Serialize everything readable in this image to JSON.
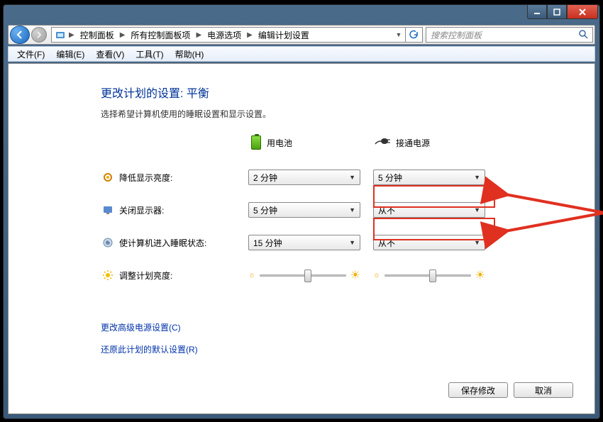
{
  "breadcrumb": {
    "items": [
      "控制面板",
      "所有控制面板项",
      "电源选项",
      "编辑计划设置"
    ]
  },
  "search": {
    "placeholder": "搜索控制面板"
  },
  "menu": {
    "file": "文件(F)",
    "edit": "编辑(E)",
    "view": "查看(V)",
    "tools": "工具(T)",
    "help": "帮助(H)"
  },
  "page": {
    "title": "更改计划的设置: 平衡",
    "subtitle": "选择希望计算机使用的睡眠设置和显示设置。"
  },
  "columns": {
    "battery": "用电池",
    "plugged": "接通电源"
  },
  "rows": {
    "dim": {
      "label": "降低显示亮度:",
      "battery": "2 分钟",
      "plugged": "5 分钟"
    },
    "off": {
      "label": "关闭显示器:",
      "battery": "5 分钟",
      "plugged": "从不"
    },
    "sleep": {
      "label": "使计算机进入睡眠状态:",
      "battery": "15 分钟",
      "plugged": "从不"
    },
    "bright": {
      "label": "调整计划亮度:"
    }
  },
  "links": {
    "advanced": "更改高级电源设置(C)",
    "restore": "还原此计划的默认设置(R)"
  },
  "buttons": {
    "save": "保存修改",
    "cancel": "取消"
  }
}
